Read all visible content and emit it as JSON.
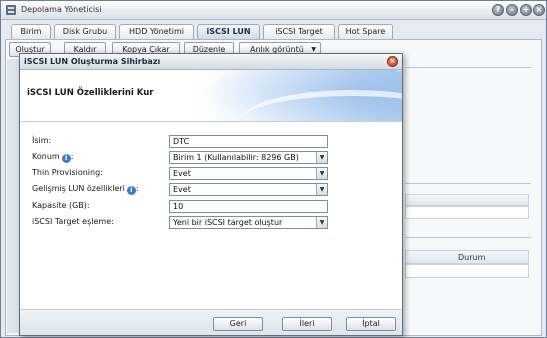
{
  "window": {
    "title": "Depolama Yöneticisi"
  },
  "tabs": [
    {
      "label": "Birim"
    },
    {
      "label": "Disk Grubu"
    },
    {
      "label": "HDD Yönetimi"
    },
    {
      "label": "iSCSI LUN",
      "active": true
    },
    {
      "label": "iSCSI Target"
    },
    {
      "label": "Hot Spare"
    }
  ],
  "toolbar": {
    "create": "Oluştur",
    "remove": "Kaldır",
    "clone": "Kopya Çıkar",
    "edit": "Düzenle",
    "snapshot": "Anlık görüntü"
  },
  "background": {
    "status_column": "Durum"
  },
  "dialog": {
    "title": "iSCSI LUN Oluşturma Sihirbazı",
    "heading": "iSCSI LUN Özelliklerini Kur",
    "fields": {
      "name_label": "İsim:",
      "name_value": "DTC",
      "location_label": "Konum",
      "location_value": "Birim 1 (Kullanılabilir: 8296 GB)",
      "thin_label": "Thin Provisioning:",
      "thin_value": "Evet",
      "advanced_label": "Gelişmiş LUN özellikleri",
      "advanced_value": "Evet",
      "capacity_label": "Kapasite (GB):",
      "capacity_value": "10",
      "target_label": "iSCSI Target eşleme:",
      "target_value": "Yeni bir iSCSI target oluştur"
    },
    "buttons": {
      "back": "Geri",
      "next": "İleri",
      "cancel": "İptal"
    }
  },
  "colors": {
    "accent": "#3a7bc8",
    "close": "#c9341a",
    "header_gradient_end": "#b9d2ee"
  }
}
